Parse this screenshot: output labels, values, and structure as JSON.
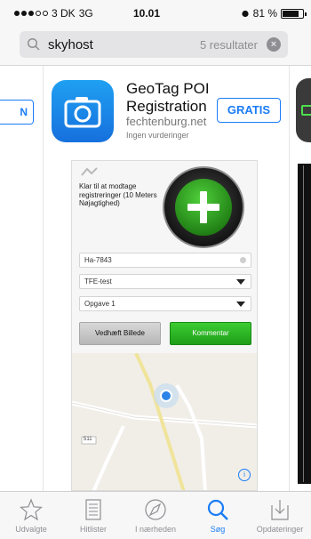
{
  "status_bar": {
    "carrier": "3 DK",
    "network": "3G",
    "time": "10.01",
    "battery": "81 %",
    "battery_level": 0.81
  },
  "search": {
    "query": "skyhost",
    "results_count": "5 resultater"
  },
  "results": {
    "previous_button_label": "N",
    "app": {
      "title": "GeoTag POI Registration",
      "developer": "fechtenburg.net",
      "rating": "Ingen vurderinger",
      "get_button_label": "GRATIS"
    }
  },
  "screenshot": {
    "note": "Klar til at modtage registreringer (10 Meters Nøjagtighed)",
    "id_field": "Ha-7843",
    "select_1": "TFE-test",
    "select_2": "Opgave 1",
    "attach_button": "Vedhæft Billede",
    "comment_button": "Kommentar",
    "map_road_label": "511"
  },
  "tabs": [
    {
      "label": "Udvalgte",
      "icon": "star-icon"
    },
    {
      "label": "Hitlister",
      "icon": "list-icon"
    },
    {
      "label": "I nærheden",
      "icon": "compass-icon"
    },
    {
      "label": "Søg",
      "icon": "search-icon"
    },
    {
      "label": "Opdateringer",
      "icon": "download-icon"
    }
  ],
  "colors": {
    "accent": "#1a7cf5",
    "app_icon": "#1670dd",
    "comment_button": "#2aaf21"
  }
}
